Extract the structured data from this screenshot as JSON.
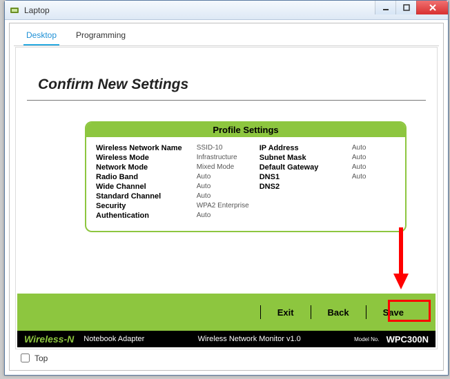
{
  "window": {
    "title": "Laptop"
  },
  "tabs": {
    "desktop": "Desktop",
    "programming": "Programming"
  },
  "heading": "Confirm New Settings",
  "profile": {
    "header": "Profile Settings",
    "left": [
      {
        "label": "Wireless Network Name",
        "value": "SSID-10"
      },
      {
        "label": "Wireless Mode",
        "value": "Infrastructure"
      },
      {
        "label": "Network Mode",
        "value": "Mixed Mode"
      },
      {
        "label": "Radio Band",
        "value": "Auto"
      },
      {
        "label": "Wide Channel",
        "value": "Auto"
      },
      {
        "label": "Standard Channel",
        "value": "Auto"
      },
      {
        "label": "Security",
        "value": "WPA2 Enterprise"
      },
      {
        "label": "Authentication",
        "value": "Auto"
      }
    ],
    "right": [
      {
        "label": "IP Address",
        "value": "Auto"
      },
      {
        "label": "Subnet Mask",
        "value": "Auto"
      },
      {
        "label": "Default Gateway",
        "value": "Auto"
      },
      {
        "label": "DNS1",
        "value": "Auto"
      },
      {
        "label": "DNS2",
        "value": ""
      }
    ]
  },
  "actions": {
    "exit": "Exit",
    "back": "Back",
    "save": "Save"
  },
  "footer": {
    "brand": "Wireless-N",
    "product": "Notebook Adapter",
    "app": "Wireless Network Monitor  v1.0",
    "model_label": "Model No.",
    "model": "WPC300N"
  },
  "top_checkbox": "Top"
}
